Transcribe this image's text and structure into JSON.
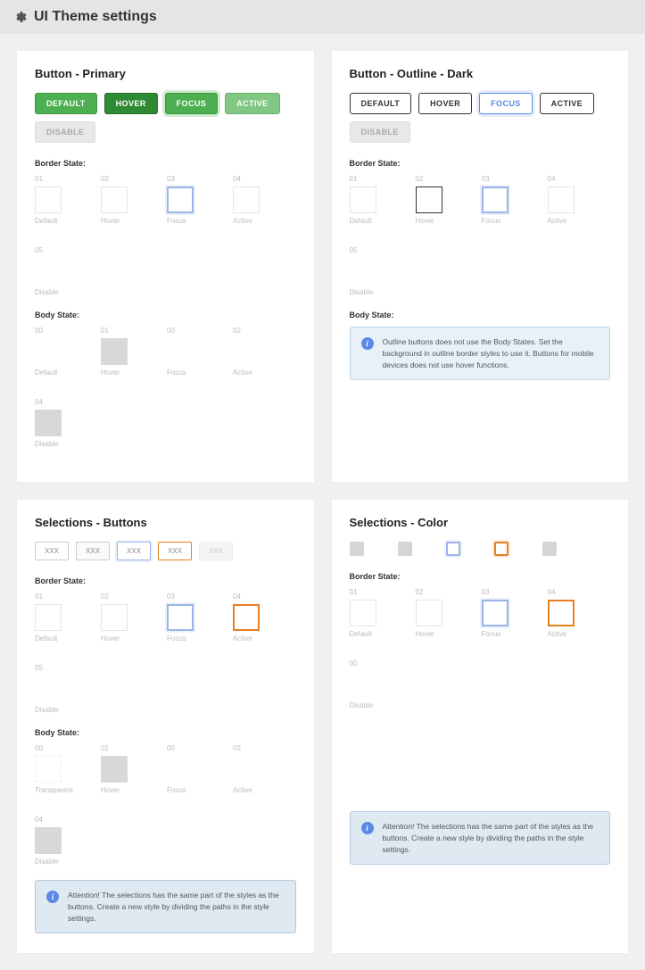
{
  "page": {
    "title": "UI Theme settings"
  },
  "cards": {
    "primary": {
      "title": "Button - Primary",
      "buttons": [
        "DEFAULT",
        "HOVER",
        "FOCUS",
        "ACTIVE",
        "DISABLE"
      ]
    },
    "outline": {
      "title": "Button - Outline - Dark",
      "buttons": [
        "DEFAULT",
        "HOVER",
        "FOCUS",
        "ACTIVE",
        "DISABLE"
      ],
      "notice": "Outline buttons does not use the Body States. Set the background in outline border styles to use it. Buttons for mobile devices does not use hover functions."
    },
    "selButtons": {
      "title": "Selections - Buttons",
      "items": [
        "XXX",
        "XXX",
        "XXX",
        "XXX",
        "XXX"
      ],
      "notice": "Attention! The selections has the same part of the styles as the buttons. Create a new style by dividing the paths in the style settings."
    },
    "selColor": {
      "title": "Selections - Color",
      "notice": "Attention! The selections has the same part of the styles as the buttons. Create a new style by dividing the paths in the style settings."
    }
  },
  "labels": {
    "borderState": "Border State:",
    "bodyState": "Body State:"
  },
  "nums": {
    "n0": "00",
    "n1": "01",
    "n2": "02",
    "n3": "03",
    "n4": "04",
    "n5": "05"
  },
  "states": {
    "default": "Default",
    "hover": "Hover",
    "focus": "Focus",
    "active": "Active",
    "disable": "Disable",
    "transparent": "Transparent"
  }
}
